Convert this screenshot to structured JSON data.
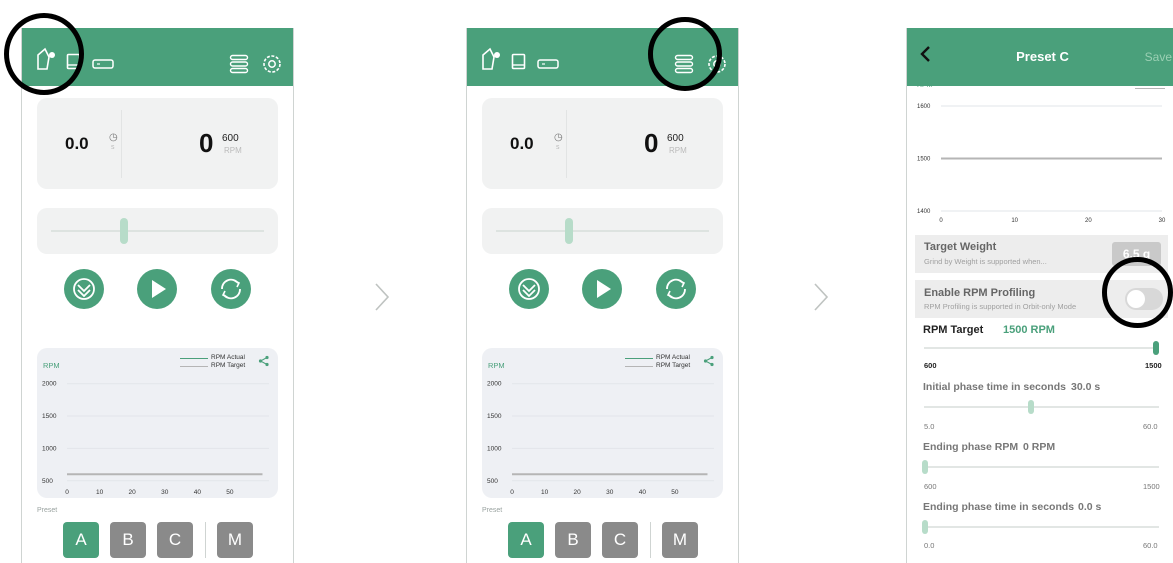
{
  "screens": [
    {
      "id": "p1",
      "time_value": "0.0",
      "time_unit": "s",
      "rpm_value": "0",
      "rpm_target_small": "600",
      "rpm_unit": "RPM",
      "chart_ylabel": "RPM",
      "legend": [
        "RPM Actual",
        "RPM Target"
      ],
      "preset_label": "Preset",
      "presets": [
        "A",
        "B",
        "C",
        "M"
      ],
      "highlight": "device-icons"
    },
    {
      "id": "p2",
      "time_value": "0.0",
      "time_unit": "s",
      "rpm_value": "0",
      "rpm_target_small": "600",
      "rpm_unit": "RPM",
      "chart_ylabel": "RPM",
      "legend": [
        "RPM Actual",
        "RPM Target"
      ],
      "preset_label": "Preset",
      "presets": [
        "A",
        "B",
        "C",
        "M"
      ],
      "highlight": "presets-menu-icon"
    }
  ],
  "chart_data": [
    {
      "type": "line",
      "ylabel": "RPM",
      "x_ticks": [
        0,
        10,
        20,
        30,
        40,
        50
      ],
      "y_ticks": [
        500,
        1000,
        1500,
        2000
      ],
      "ylim": [
        450,
        2150
      ],
      "series": [
        {
          "name": "RPM Actual",
          "x": [],
          "y": [],
          "color": "#4aa07b"
        },
        {
          "name": "RPM Target",
          "x": [
            0,
            60
          ],
          "y": [
            600,
            600
          ],
          "color": "#b5b5b5"
        }
      ],
      "legend_position": "top-right"
    },
    {
      "type": "line",
      "ylabel": "RPM",
      "x_ticks": [
        0,
        10,
        20,
        30,
        40,
        50
      ],
      "y_ticks": [
        500,
        1000,
        1500,
        2000
      ],
      "ylim": [
        450,
        2150
      ],
      "series": [
        {
          "name": "RPM Actual",
          "x": [],
          "y": [],
          "color": "#4aa07b"
        },
        {
          "name": "RPM Target",
          "x": [
            0,
            60
          ],
          "y": [
            600,
            600
          ],
          "color": "#b5b5b5"
        }
      ],
      "legend_position": "top-right"
    },
    {
      "type": "line",
      "ylabel": "RPM",
      "x_ticks": [
        0,
        10,
        20,
        30
      ],
      "y_ticks": [
        1400,
        1500,
        1600
      ],
      "ylim": [
        1400,
        1600
      ],
      "series": [
        {
          "name": "",
          "x": [
            0,
            30
          ],
          "y": [
            1500,
            1500
          ],
          "color": "#b5b5b5"
        }
      ]
    }
  ],
  "preset_screen": {
    "title": "Preset C",
    "save_label": "Save",
    "chart_ylabel": "RPM",
    "target_weight": {
      "title": "Target Weight",
      "subtitle": "Grind by Weight is supported when...",
      "value": "6.5 g"
    },
    "rpm_profiling": {
      "title": "Enable RPM Profiling",
      "subtitle": "RPM Profiling is supported in Orbit-only Mode",
      "enabled": false
    },
    "rpm_target": {
      "label": "RPM Target",
      "value": "1500 RPM",
      "min": "600",
      "max": "1500",
      "level": 1.0
    },
    "initial_phase": {
      "label": "Initial phase time in seconds",
      "value": "30.0 s",
      "min": "5.0",
      "max": "60.0",
      "level": 0.45
    },
    "ending_rpm": {
      "label": "Ending phase RPM",
      "value": "0 RPM",
      "min": "600",
      "max": "1500",
      "level": 0.0
    },
    "ending_time": {
      "label": "Ending phase time in seconds",
      "value": "0.0 s",
      "min": "0.0",
      "max": "60.0",
      "level": 0.0
    }
  },
  "colors": {
    "brand_green": "#4aa07b",
    "light_green": "#b7dcc9",
    "preset_gray": "#8a8a8a"
  }
}
